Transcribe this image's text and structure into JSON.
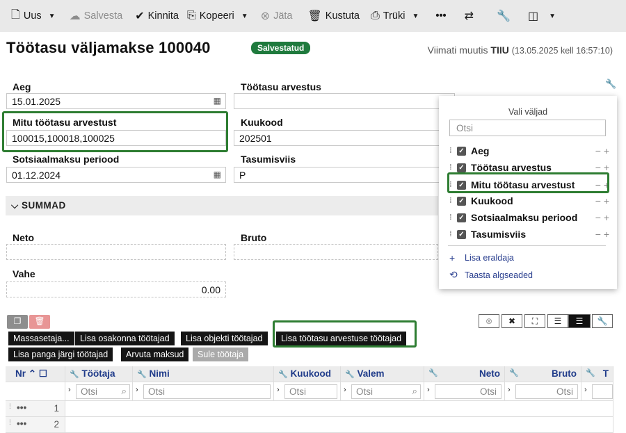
{
  "toolbar": {
    "new": "Uus",
    "save": "Salvesta",
    "confirm": "Kinnita",
    "copy": "Kopeeri",
    "leave": "Jäta",
    "delete": "Kustuta",
    "print": "Trüki",
    "more": "•••"
  },
  "header": {
    "title": "Töötasu väljamakse 100040",
    "status": "Salvestatud",
    "modified_prefix": "Viimati muutis",
    "modified_user": "TIIU",
    "modified_time": "(13.05.2025 kell 16:57:10)"
  },
  "form": {
    "aeg_label": "Aeg",
    "aeg_value": "15.01.2025",
    "arvestus_label": "Töötasu arvestus",
    "arvestus_value": "",
    "mitu_label": "Mitu töötasu arvestust",
    "mitu_value": "100015,100018,100025",
    "kuukood_label": "Kuukood",
    "kuukood_value": "202501",
    "sots_label": "Sotsiaalmaksu periood",
    "sots_value": "01.12.2024",
    "tasumisviis_label": "Tasumisviis",
    "tasumisviis_value": "P"
  },
  "summad": {
    "section": "SUMMAD",
    "neto_label": "Neto",
    "bruto_label": "Bruto",
    "vahe_label": "Vahe",
    "vahe_value": "0.00"
  },
  "buttons": {
    "row1": [
      "Massasetaja...",
      "Lisa osakonna töötajad",
      "Lisa objekti töötajad",
      "Lisa töötasu arvestuse töötajad"
    ],
    "row2": [
      "Lisa panga järgi töötajad",
      "Arvuta maksud",
      "Sule töötaja"
    ]
  },
  "panel": {
    "title": "Vali väljad",
    "search_placeholder": "Otsi",
    "fields": [
      "Aeg",
      "Töötasu arvestus",
      "Mitu töötasu arvestust",
      "Kuukood",
      "Sotsiaalmaksu periood",
      "Tasumisviis"
    ],
    "add_separator": "Lisa eraldaja",
    "restore": "Taasta algseaded"
  },
  "grid": {
    "columns": [
      "Nr",
      "Töötaja",
      "Nimi",
      "Kuukood",
      "Valem",
      "Neto",
      "Bruto",
      "T"
    ],
    "search": "Otsi",
    "rows": [
      "1",
      "2"
    ]
  }
}
